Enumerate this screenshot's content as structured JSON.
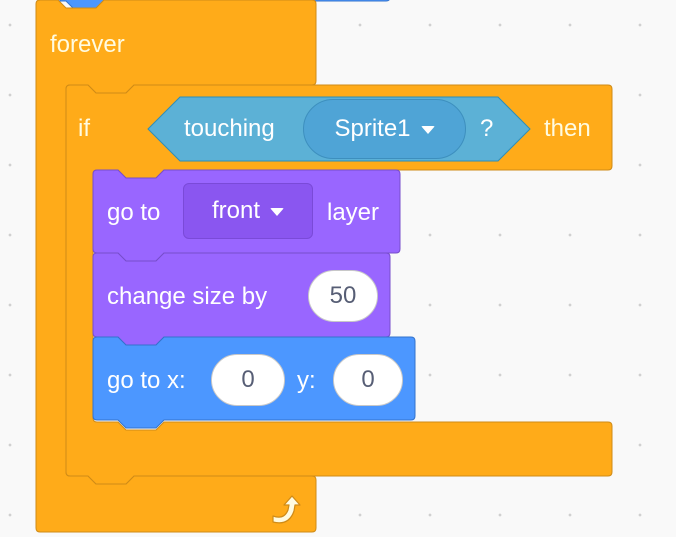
{
  "workspace": {
    "background_color": "#f9f9f9",
    "grid": "dotted"
  },
  "colors": {
    "control": "#FFAB19",
    "control_border": "#CF8B17",
    "looks": "#9966FF",
    "looks_border": "#774DCB",
    "motion": "#4C97FF",
    "motion_border": "#3373CC",
    "sensing": "#5CB1D6",
    "sensing_border": "#2E8EB8"
  },
  "blocks": {
    "previous_block": {
      "category": "motion"
    },
    "forever": {
      "label": "forever",
      "loop_icon": "loop-arrow-icon"
    },
    "if_then": {
      "if_label": "if",
      "then_label": "then",
      "condition": {
        "label": "touching",
        "dropdown_value": "Sprite1",
        "question_mark": "?"
      }
    },
    "go_to_layer": {
      "label_before": "go to",
      "dropdown_value": "front",
      "label_after": "layer"
    },
    "change_size": {
      "label": "change size by",
      "value": "50"
    },
    "go_to_xy": {
      "label_x": "go to x:",
      "x_value": "0",
      "label_y": "y:",
      "y_value": "0"
    }
  }
}
